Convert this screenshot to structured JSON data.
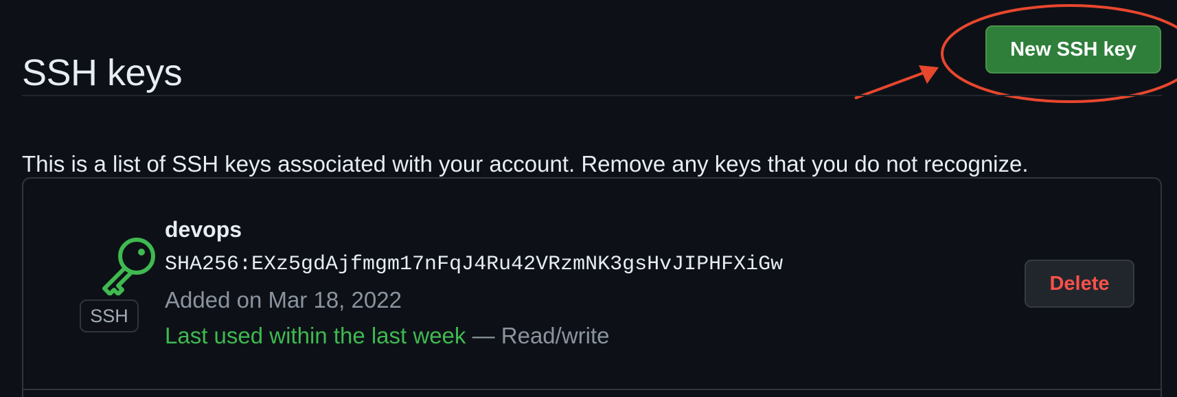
{
  "header": {
    "title": "SSH keys",
    "new_key_label": "New SSH key"
  },
  "description": "This is a list of SSH keys associated with your account. Remove any keys that you do not recognize.",
  "keys": [
    {
      "name": "devops",
      "fingerprint": "SHA256:EXz5gdAjfmgm17nFqJ4Ru42VRzmNK3gsHvJIPHFXiGw",
      "added": "Added on Mar 18, 2022",
      "last_used": "Last used within the last week",
      "access": "— Read/write",
      "badge": "SSH",
      "icon": "key-icon",
      "delete_label": "Delete"
    }
  ],
  "colors": {
    "background": "#0d1117",
    "primary_button": "#2f7f3b",
    "danger_text": "#f85149",
    "success_text": "#3fb950",
    "annotation": "#e8472e"
  }
}
